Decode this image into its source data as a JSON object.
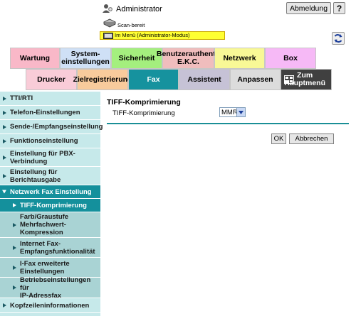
{
  "header": {
    "user": "Administrator",
    "logout_label": "Abmeldung",
    "help_label": "?",
    "scan_status": "Scan-bereit",
    "mode_text": "Im Menü (Administrator-Modus)"
  },
  "tabs_row1": [
    {
      "label": "Wartung",
      "color": "#f9b8c8"
    },
    {
      "label": "System-\neinstellungen",
      "color": "#cfe0f6"
    },
    {
      "label": "Sicherheit",
      "color": "#a4ef7e"
    },
    {
      "label": "Benutzerauthentif\nE.K.C.",
      "color": "#f0bdbd"
    },
    {
      "label": "Netzwerk",
      "color": "#f8f896"
    },
    {
      "label": "Box",
      "color": "#f6b9f6"
    }
  ],
  "tabs_row2": [
    {
      "label": "Drucker",
      "color": "#f9ccd8"
    },
    {
      "label": "Zielregistrierung",
      "color": "#f8cb9c"
    },
    {
      "label": "Fax",
      "color": "#16929e",
      "active": true
    },
    {
      "label": "Assistent",
      "color": "#c6c2d6"
    },
    {
      "label": "Anpassen",
      "color": "#dcdcdc"
    },
    {
      "label": "Zum\nHauptmenü",
      "color": "#404040"
    }
  ],
  "sidebar": {
    "items": [
      {
        "label": "TTI/RTI"
      },
      {
        "label": "Telefon-Einstellungen"
      },
      {
        "label": "Sende-/Empfangseinstellung"
      },
      {
        "label": "Funktionseinstellung"
      },
      {
        "label": "Einstellung für PBX-\nVerbindung"
      },
      {
        "label": "Einstellung für\nBerichtausgabe"
      },
      {
        "label": "Netzwerk Fax Einstellung"
      },
      {
        "label": "TIFF-Komprimierung"
      },
      {
        "label": "Farb/Graustufe\nMehrfachwert-\nKompression"
      },
      {
        "label": "Internet Fax-\nEmpfangsfunktionalität"
      },
      {
        "label": "I-Fax erweiterte\nEinstellungen"
      },
      {
        "label": "Betriebseinstellungen für\nIP-Adressfax"
      },
      {
        "label": "Kopfzeileninformationen"
      }
    ]
  },
  "content": {
    "title": "TIFF-Komprimierung",
    "field_label": "TIFF-Komprimierung",
    "field_value": "MMR",
    "ok_label": "OK",
    "cancel_label": "Abbrechen"
  },
  "colors": {
    "accent": "#16929e",
    "sidebar_bg": "#c6e9ea",
    "sidebar_sub_bg": "#a9d3d4",
    "mode_bar": "#ffff33"
  }
}
